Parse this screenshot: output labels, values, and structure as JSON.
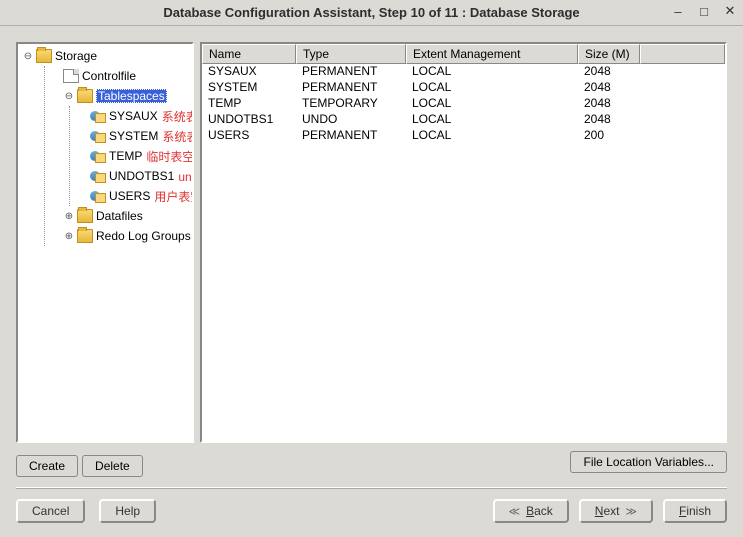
{
  "window": {
    "title": "Database Configuration Assistant, Step 10 of 11 : Database Storage"
  },
  "tree": {
    "root": "Storage",
    "controlfile": "Controlfile",
    "tablespaces": "Tablespaces",
    "ts_items": [
      {
        "name": "SYSAUX",
        "annot": "系统表空间"
      },
      {
        "name": "SYSTEM",
        "annot": "系统表空间"
      },
      {
        "name": "TEMP",
        "annot": "临时表空间"
      },
      {
        "name": "UNDOTBS1",
        "annot": "undo表空间"
      },
      {
        "name": "USERS",
        "annot": "用户表空间"
      }
    ],
    "datafiles": "Datafiles",
    "redolog": "Redo Log Groups"
  },
  "table": {
    "headers": {
      "name": "Name",
      "type": "Type",
      "ext": "Extent Management",
      "size": "Size (M)"
    },
    "rows": [
      {
        "name": "SYSAUX",
        "type": "PERMANENT",
        "ext": "LOCAL",
        "size": "2048"
      },
      {
        "name": "SYSTEM",
        "type": "PERMANENT",
        "ext": "LOCAL",
        "size": "2048"
      },
      {
        "name": "TEMP",
        "type": "TEMPORARY",
        "ext": "LOCAL",
        "size": "2048"
      },
      {
        "name": "UNDOTBS1",
        "type": "UNDO",
        "ext": "LOCAL",
        "size": "2048"
      },
      {
        "name": "USERS",
        "type": "PERMANENT",
        "ext": "LOCAL",
        "size": "200"
      }
    ]
  },
  "buttons": {
    "create": "Create",
    "delete": "Delete",
    "file_loc": "File Location Variables...",
    "cancel": "Cancel",
    "help": "Help",
    "back": "Back",
    "next": "Next",
    "finish": "Finish"
  }
}
